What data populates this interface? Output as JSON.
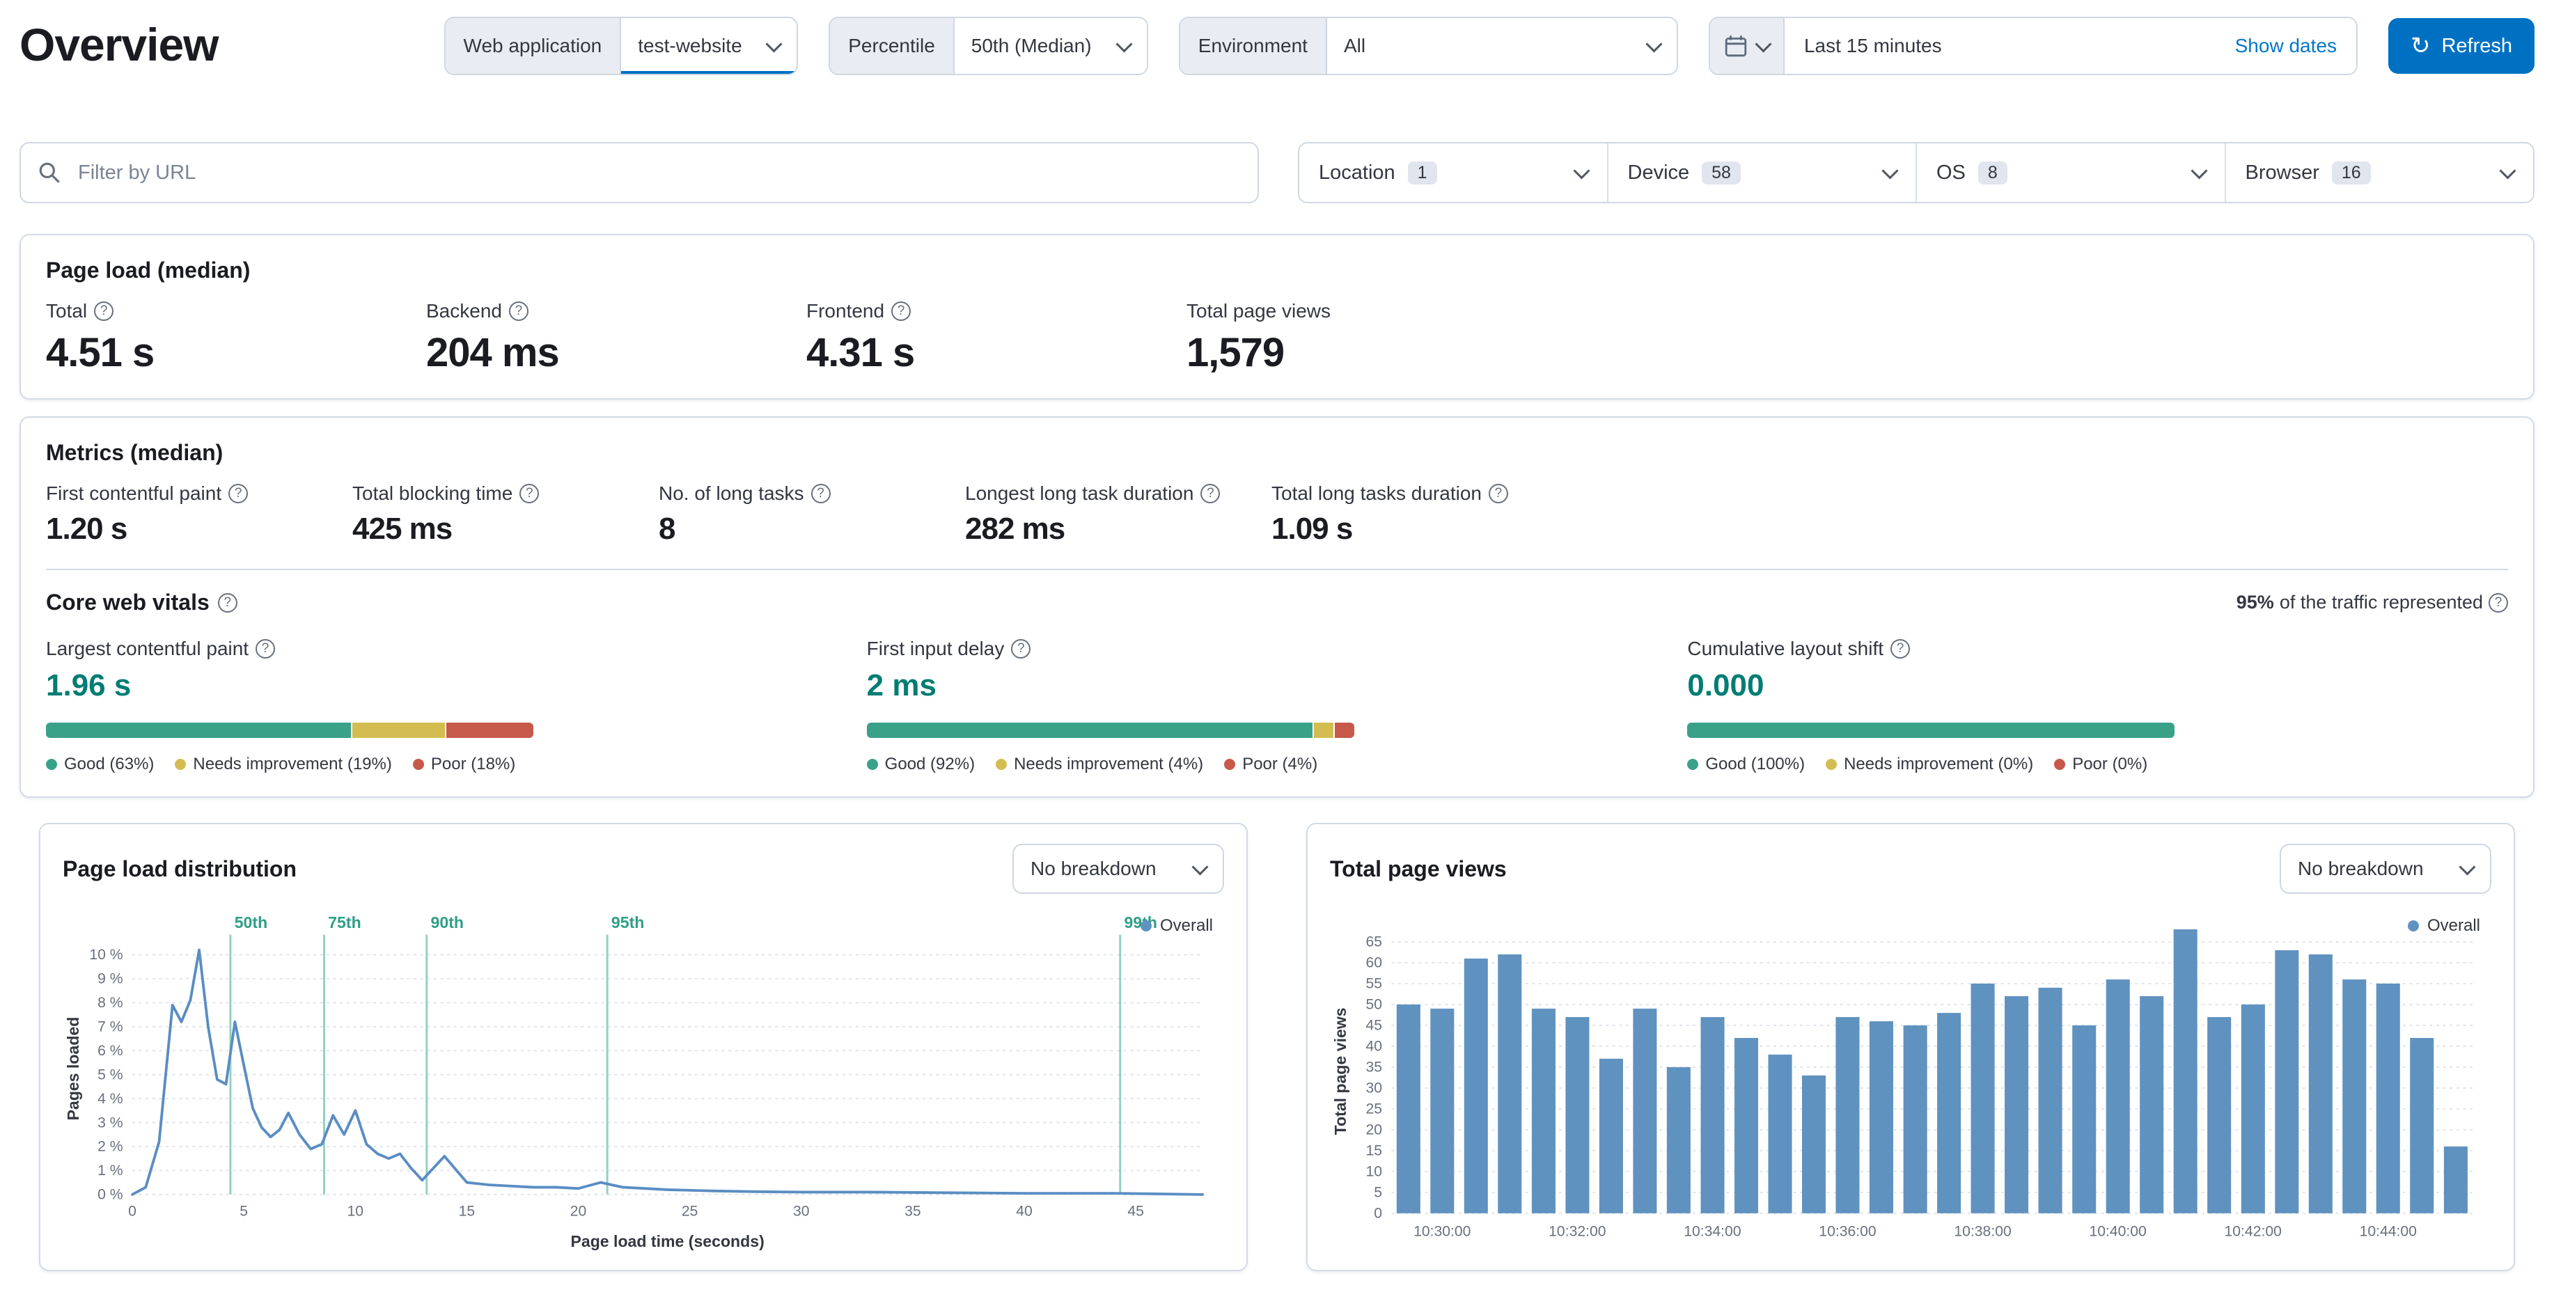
{
  "icons": {
    "search-icon": "magnifier",
    "calendar-icon": "calendar",
    "chevron-down-icon": "chevron",
    "info-icon": "?",
    "refresh-icon": "↻",
    "legend-dot": "●"
  },
  "colors": {
    "primary_button": "#0071c2",
    "link": "#0077cc",
    "good": "#3aa189",
    "needs_improvement": "#d3bd51",
    "poor": "#c6594a",
    "vital_value_text": "#017d73",
    "series_blue": "#6092c0",
    "percentile_marker_line": "#8fd0c0"
  },
  "header": {
    "title": "Overview",
    "web_application": {
      "label": "Web application",
      "value": "test-website"
    },
    "percentile": {
      "label": "Percentile",
      "value": "50th (Median)"
    },
    "environment": {
      "label": "Environment",
      "value": "All"
    },
    "time_range": {
      "value": "Last 15 minutes",
      "show_dates_label": "Show dates"
    },
    "refresh_label": "Refresh"
  },
  "filters": {
    "url_filter_placeholder": "Filter by URL",
    "items": [
      {
        "label": "Location",
        "count": "1"
      },
      {
        "label": "Device",
        "count": "58"
      },
      {
        "label": "OS",
        "count": "8"
      },
      {
        "label": "Browser",
        "count": "16"
      }
    ]
  },
  "page_load": {
    "title": "Page load (median)",
    "stats": [
      {
        "label": "Total",
        "value": "4.51 s"
      },
      {
        "label": "Backend",
        "value": "204 ms"
      },
      {
        "label": "Frontend",
        "value": "4.31 s"
      },
      {
        "label": "Total page views",
        "value": "1,579"
      }
    ]
  },
  "metrics": {
    "title": "Metrics (median)",
    "stats": [
      {
        "label": "First contentful paint",
        "value": "1.20 s"
      },
      {
        "label": "Total blocking time",
        "value": "425 ms"
      },
      {
        "label": "No. of long tasks",
        "value": "8"
      },
      {
        "label": "Longest long task duration",
        "value": "282 ms"
      },
      {
        "label": "Total long tasks duration",
        "value": "1.09 s"
      }
    ]
  },
  "core_web_vitals": {
    "title": "Core web vitals",
    "traffic_note_percent": "95%",
    "traffic_note_rest": " of the traffic represented",
    "vitals": [
      {
        "label": "Largest contentful paint",
        "value": "1.96 s",
        "good_pct": 63,
        "ni_pct": 19,
        "poor_pct": 18,
        "legend": [
          "Good (63%)",
          "Needs improvement (19%)",
          "Poor (18%)"
        ]
      },
      {
        "label": "First input delay",
        "value": "2 ms",
        "good_pct": 92,
        "ni_pct": 4,
        "poor_pct": 4,
        "legend": [
          "Good (92%)",
          "Needs improvement (4%)",
          "Poor (4%)"
        ]
      },
      {
        "label": "Cumulative layout shift",
        "value": "0.000",
        "good_pct": 100,
        "ni_pct": 0,
        "poor_pct": 0,
        "legend": [
          "Good (100%)",
          "Needs improvement (0%)",
          "Poor (0%)"
        ]
      }
    ]
  },
  "page_load_distribution_panel": {
    "title": "Page load distribution",
    "breakdown_value": "No breakdown"
  },
  "total_page_views_panel": {
    "title": "Total page views",
    "breakdown_value": "No breakdown"
  },
  "chart_data": [
    {
      "type": "line",
      "title": "Page load distribution",
      "xlabel": "Page load time (seconds)",
      "ylabel": "Pages loaded",
      "xlim": [
        0,
        48
      ],
      "ylim": [
        0,
        10.5
      ],
      "x_ticks": [
        0,
        5,
        10,
        15,
        20,
        25,
        30,
        35,
        40,
        45
      ],
      "y_ticks_percent": [
        0,
        1,
        2,
        3,
        4,
        5,
        6,
        7,
        8,
        9,
        10
      ],
      "grid": true,
      "legend_position": "top-right",
      "percentile_markers": [
        {
          "label": "50th",
          "x": 4.4
        },
        {
          "label": "75th",
          "x": 8.6
        },
        {
          "label": "90th",
          "x": 13.2
        },
        {
          "label": "95th",
          "x": 21.3
        },
        {
          "label": "99th",
          "x": 44.3
        }
      ],
      "series": [
        {
          "name": "Overall",
          "x": [
            0,
            0.6,
            1.2,
            1.8,
            2.2,
            2.6,
            3,
            3.4,
            3.8,
            4.2,
            4.6,
            5,
            5.4,
            5.8,
            6.2,
            6.6,
            7,
            7.5,
            8,
            8.5,
            9,
            9.5,
            10,
            10.5,
            11,
            11.5,
            12,
            12.5,
            13,
            14,
            15,
            16,
            17,
            18,
            19,
            20,
            21,
            22,
            23,
            24,
            26,
            28,
            30,
            33,
            36,
            40,
            44,
            48
          ],
          "y": [
            0,
            0.3,
            2.2,
            7.9,
            7.2,
            8.1,
            10.2,
            7,
            4.8,
            4.6,
            7.2,
            5.4,
            3.6,
            2.8,
            2.4,
            2.7,
            3.4,
            2.5,
            1.9,
            2.1,
            3.3,
            2.5,
            3.5,
            2.1,
            1.7,
            1.5,
            1.7,
            1.1,
            0.6,
            1.6,
            0.5,
            0.4,
            0.35,
            0.3,
            0.3,
            0.25,
            0.5,
            0.3,
            0.25,
            0.2,
            0.15,
            0.12,
            0.1,
            0.1,
            0.08,
            0.05,
            0.05,
            0
          ]
        }
      ]
    },
    {
      "type": "bar",
      "title": "Total page views",
      "xlabel": "",
      "ylabel": "Total page views",
      "ylim": [
        0,
        68
      ],
      "y_ticks": [
        0,
        5,
        10,
        15,
        20,
        25,
        30,
        35,
        40,
        45,
        50,
        55,
        60,
        65
      ],
      "grid": true,
      "legend_position": "top-right",
      "x_tick_labels": [
        "10:30:00",
        "10:32:00",
        "10:34:00",
        "10:36:00",
        "10:38:00",
        "10:40:00",
        "10:42:00",
        "10:44:00"
      ],
      "series": [
        {
          "name": "Overall",
          "x": [
            "10:29:30",
            "10:30:00",
            "10:30:30",
            "10:31:00",
            "10:31:30",
            "10:32:00",
            "10:32:30",
            "10:33:00",
            "10:33:30",
            "10:34:00",
            "10:34:30",
            "10:35:00",
            "10:35:30",
            "10:36:00",
            "10:36:30",
            "10:37:00",
            "10:37:30",
            "10:38:00",
            "10:38:30",
            "10:39:00",
            "10:39:30",
            "10:40:00",
            "10:40:30",
            "10:41:00",
            "10:41:30",
            "10:42:00",
            "10:42:30",
            "10:43:00",
            "10:43:30",
            "10:44:00",
            "10:44:30",
            "10:45:00"
          ],
          "values": [
            50,
            49,
            61,
            62,
            49,
            47,
            37,
            49,
            35,
            47,
            42,
            38,
            33,
            47,
            46,
            45,
            48,
            55,
            52,
            54,
            45,
            56,
            52,
            68,
            47,
            50,
            63,
            62,
            56,
            55,
            42,
            16
          ]
        }
      ]
    }
  ]
}
